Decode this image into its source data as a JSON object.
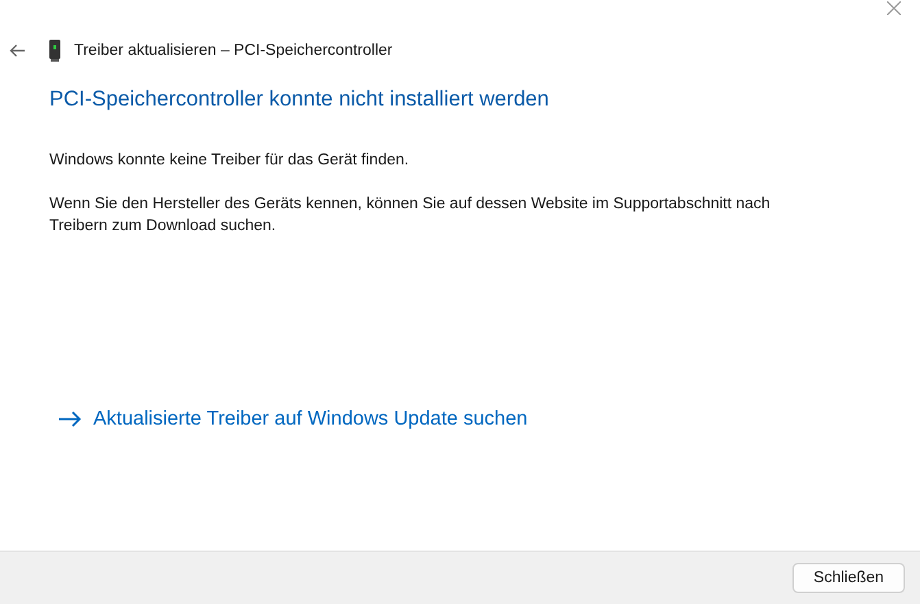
{
  "window": {
    "title": "Treiber aktualisieren – PCI-Speichercontroller"
  },
  "heading": "PCI-Speichercontroller konnte nicht installiert werden",
  "paragraphs": [
    "Windows konnte keine Treiber für das Gerät finden.",
    "Wenn Sie den Hersteller des Geräts kennen, können Sie auf dessen Website im Supportabschnitt nach Treibern zum Download suchen."
  ],
  "link": {
    "label": "Aktualisierte Treiber auf Windows Update suchen"
  },
  "buttons": [
    "Schließen"
  ]
}
